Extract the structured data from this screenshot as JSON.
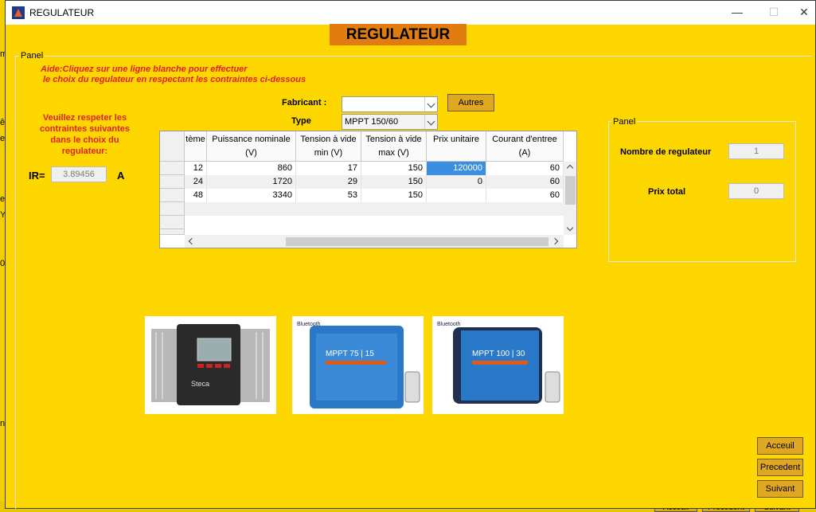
{
  "window": {
    "title": "REGULATEUR",
    "min": "—",
    "max": "☐",
    "close": "✕"
  },
  "header": {
    "title": "REGULATEUR"
  },
  "panel": {
    "label": "Panel"
  },
  "aide": {
    "line1": "Aide:Cliquez sur une ligne blanche pour effectuer",
    "line2": "le choix du regulateur en respectant les contraintes ci-dessous"
  },
  "contraintes": {
    "text": "Veuillez respeter les contraintes suivantes dans le choix du regulateur:"
  },
  "ir": {
    "label": "IR=",
    "value": "3.89456",
    "unit": "A"
  },
  "fabricant": {
    "label": "Fabricant :",
    "value": ""
  },
  "type": {
    "label": "Type",
    "value": "MPPT 150/60"
  },
  "autres_button": "Autres",
  "table": {
    "headers": [
      [
        "tème",
        ""
      ],
      [
        "Puissance nominale",
        "(V)"
      ],
      [
        "Tension à vide",
        "min (V)"
      ],
      [
        "Tension à vide",
        "max (V)"
      ],
      [
        "Prix unitaire",
        ""
      ],
      [
        "Courant d'entree",
        "(A)"
      ]
    ],
    "rows": [
      [
        "12",
        "860",
        "17",
        "150",
        "120000",
        "60"
      ],
      [
        "24",
        "1720",
        "29",
        "150",
        "0",
        "60"
      ],
      [
        "48",
        "3340",
        "53",
        "150",
        "",
        "60"
      ],
      [
        "",
        "",
        "",
        "",
        "",
        ""
      ],
      [
        "",
        "",
        "",
        "",
        "",
        ""
      ]
    ],
    "selected": "120000"
  },
  "panel2": {
    "label": "Panel",
    "nombre_label": "Nombre de regulateur",
    "nombre_value": "1",
    "prix_label": "Prix total",
    "prix_value": "0"
  },
  "products": [
    {
      "brand": "Steca"
    },
    {
      "brand": "Bluetooth",
      "model": "MPPT 75 | 15"
    },
    {
      "brand": "Bluetooth",
      "model": "MPPT 100 | 30"
    }
  ],
  "nav": {
    "accueil": "Acceuil",
    "precedent": "Precedent",
    "suivant": "Suivant"
  },
  "background_app": {
    "items": [
      "m",
      "ê",
      "e",
      "er",
      "Y",
      "0",
      "n"
    ],
    "buttons": [
      "Acceuil",
      "Precedent",
      "Suivant"
    ]
  },
  "colors": {
    "window_bg": "#ffd700",
    "title_bg": "#e07c10",
    "help_red": "#e02020",
    "button": "#e0a820",
    "selection": "#3b8fe0"
  }
}
